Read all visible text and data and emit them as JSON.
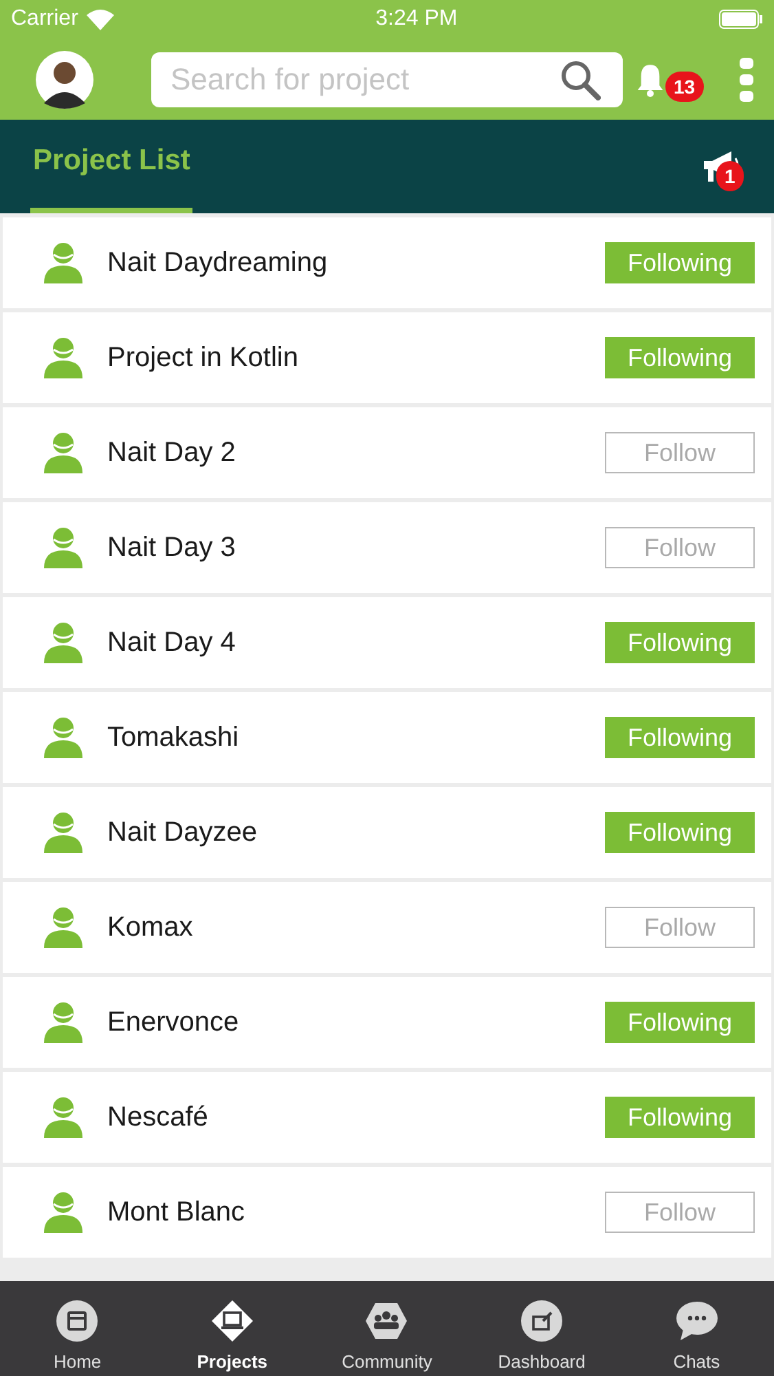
{
  "status_bar": {
    "carrier": "Carrier",
    "time": "3:24 PM"
  },
  "header": {
    "search": {
      "placeholder": "Search for project"
    },
    "notifications": "13"
  },
  "tabs": [
    {
      "label": "Project List",
      "selected": true
    }
  ],
  "announcements": "1",
  "projects": [
    {
      "name": "Nait Daydreaming",
      "following": true,
      "action": "Following"
    },
    {
      "name": "Project in Kotlin",
      "following": true,
      "action": "Following"
    },
    {
      "name": "Nait Day 2",
      "following": false,
      "action": "Follow"
    },
    {
      "name": "Nait Day 3",
      "following": false,
      "action": "Follow"
    },
    {
      "name": "Nait Day 4",
      "following": true,
      "action": "Following"
    },
    {
      "name": "Tomakashi",
      "following": true,
      "action": "Following"
    },
    {
      "name": "Nait Dayzee",
      "following": true,
      "action": "Following"
    },
    {
      "name": "Komax",
      "following": false,
      "action": "Follow"
    },
    {
      "name": "Enervonce",
      "following": true,
      "action": "Following"
    },
    {
      "name": "Nescafé",
      "following": true,
      "action": "Following"
    },
    {
      "name": "Mont Blanc",
      "following": false,
      "action": "Follow"
    }
  ],
  "nav": [
    {
      "label": "Home",
      "kind": "calendar",
      "selected": false
    },
    {
      "label": "Projects",
      "kind": "laptop",
      "selected": true
    },
    {
      "label": "Community",
      "kind": "people",
      "selected": false
    },
    {
      "label": "Dashboard",
      "kind": "edit",
      "selected": false
    },
    {
      "label": "Chats",
      "kind": "chat",
      "selected": false
    }
  ]
}
